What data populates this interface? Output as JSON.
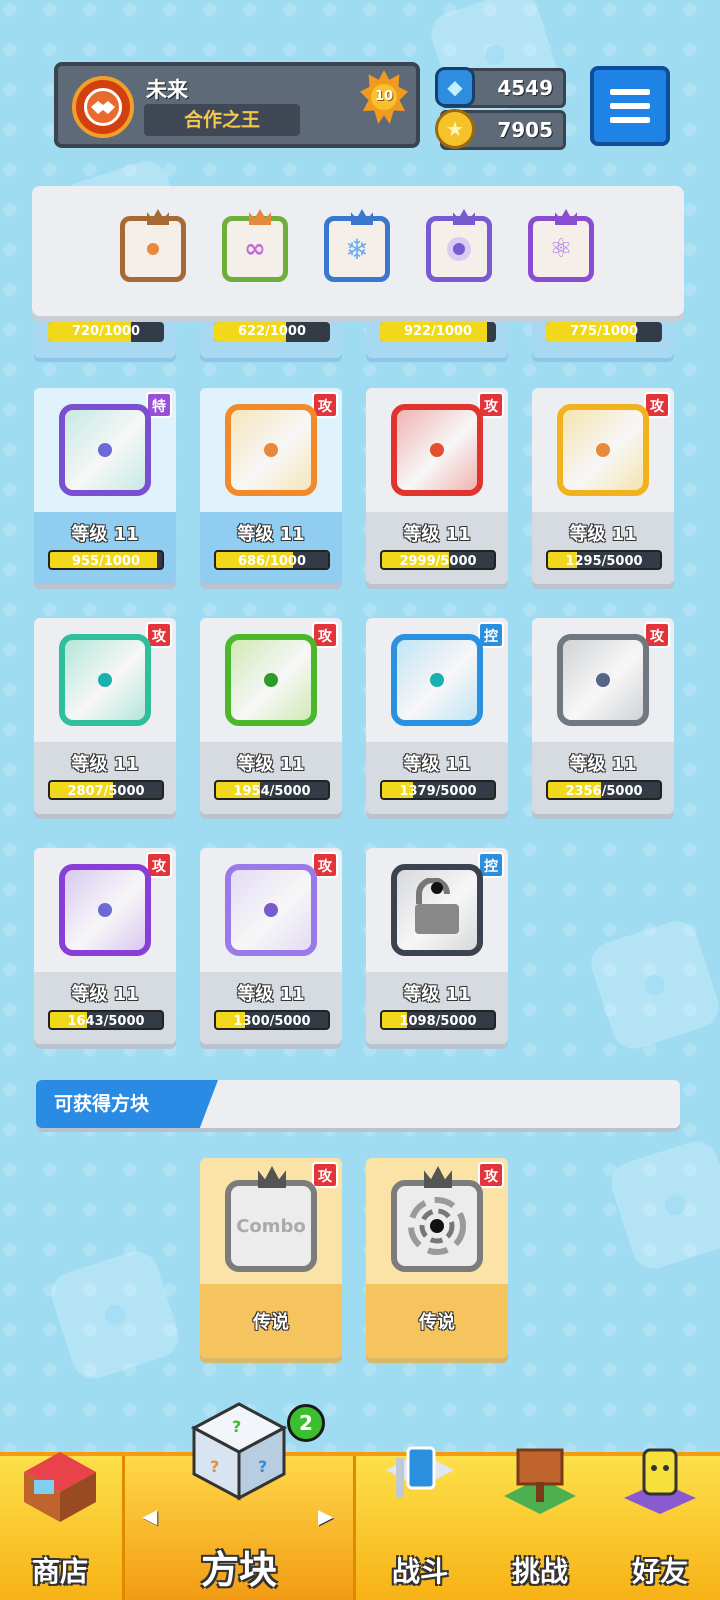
{
  "profile": {
    "name": "未来",
    "title": "合作之王",
    "level": "10"
  },
  "currency": {
    "gems": "4549",
    "coins": "7905"
  },
  "deck": [
    {
      "name": "orange-die",
      "color": "#a86a34",
      "pip": "#e8883a"
    },
    {
      "name": "infinity-die",
      "color": "#6fae3c",
      "pip": "#c46ad8"
    },
    {
      "name": "snow-die",
      "color": "#3a78d0",
      "pip": "#6aaef0"
    },
    {
      "name": "purple-die",
      "color": "#7a5ad0",
      "pip": "#7a5ad0"
    },
    {
      "name": "arcane-die",
      "color": "#8a4cd0",
      "pip": "#b07ae8"
    }
  ],
  "peek_cards": [
    "720/1000",
    "622/1000",
    "922/1000",
    "775/1000"
  ],
  "cards": [
    {
      "type": "特",
      "kind": "spc",
      "special": true,
      "border": "#7a4fd0",
      "pip": "#6a6ad8",
      "tint": "#6ad0c0",
      "level": "等级 11",
      "progress": "955/1000",
      "fraction": 0.955
    },
    {
      "type": "攻",
      "kind": "atk",
      "special": true,
      "border": "#f08a2a",
      "pip": "#e8883a",
      "tint": "#f2c44a",
      "level": "等级 11",
      "progress": "686/1000",
      "fraction": 0.686
    },
    {
      "type": "攻",
      "kind": "atk",
      "special": false,
      "border": "#e0342f",
      "pip": "#e3502f",
      "tint": "#e3342f",
      "level": "等级 11",
      "progress": "2999/5000",
      "fraction": 0.5998
    },
    {
      "type": "攻",
      "kind": "atk",
      "special": false,
      "border": "#f2b21e",
      "pip": "#e8883a",
      "tint": "#f0c028",
      "level": "等级 11",
      "progress": "1295/5000",
      "fraction": 0.259
    },
    {
      "type": "攻",
      "kind": "atk",
      "special": false,
      "border": "#2fbf9a",
      "pip": "#18b0b0",
      "tint": "#36c8a0",
      "level": "等级 11",
      "progress": "2807/5000",
      "fraction": 0.5614
    },
    {
      "type": "攻",
      "kind": "atk",
      "special": false,
      "border": "#4ab82a",
      "pip": "#2e9a2a",
      "tint": "#8ad03a",
      "level": "等级 11",
      "progress": "1954/5000",
      "fraction": 0.3908
    },
    {
      "type": "控",
      "kind": "ctl",
      "special": false,
      "border": "#2a90e0",
      "pip": "#18b0b0",
      "tint": "#5ac0f0",
      "level": "等级 11",
      "progress": "1379/5000",
      "fraction": 0.2758
    },
    {
      "type": "攻",
      "kind": "atk",
      "special": false,
      "border": "#707880",
      "pip": "#556688",
      "tint": "#8a9098",
      "level": "等级 11",
      "progress": "2356/5000",
      "fraction": 0.4712
    },
    {
      "type": "攻",
      "kind": "atk",
      "special": false,
      "border": "#8a3ed8",
      "pip": "#6a6ad8",
      "tint": "#a070e8",
      "level": "等级 11",
      "progress": "1643/5000",
      "fraction": 0.3286
    },
    {
      "type": "攻",
      "kind": "atk",
      "special": false,
      "border": "#9a7ae8",
      "pip": "#7a5ad0",
      "tint": "#c0a8f0",
      "level": "等级 11",
      "progress": "1300/5000",
      "fraction": 0.26
    },
    {
      "type": "控",
      "kind": "ctl",
      "special": false,
      "border": "#3b4350",
      "pip": "#1a1a1a",
      "tint": "#9aa0a8",
      "level": "等级 11",
      "progress": "1098/5000",
      "fraction": 0.2196
    }
  ],
  "obtainable": {
    "title": "可获得方块",
    "cards": [
      {
        "type": "攻",
        "rarity": "传说",
        "text": "Combo"
      },
      {
        "type": "攻",
        "rarity": "传说",
        "text": ""
      }
    ]
  },
  "nav": {
    "shop": "商店",
    "dice": "方块",
    "battle": "战斗",
    "challenge": "挑战",
    "friends": "好友",
    "dice_badge": "2",
    "prev_arrow": "◀",
    "next_arrow": "▶"
  },
  "icons": {
    "menu": "hamburger-icon",
    "gem": "gem-icon",
    "coin": "coin-icon",
    "avatar": "handshake-icon"
  }
}
